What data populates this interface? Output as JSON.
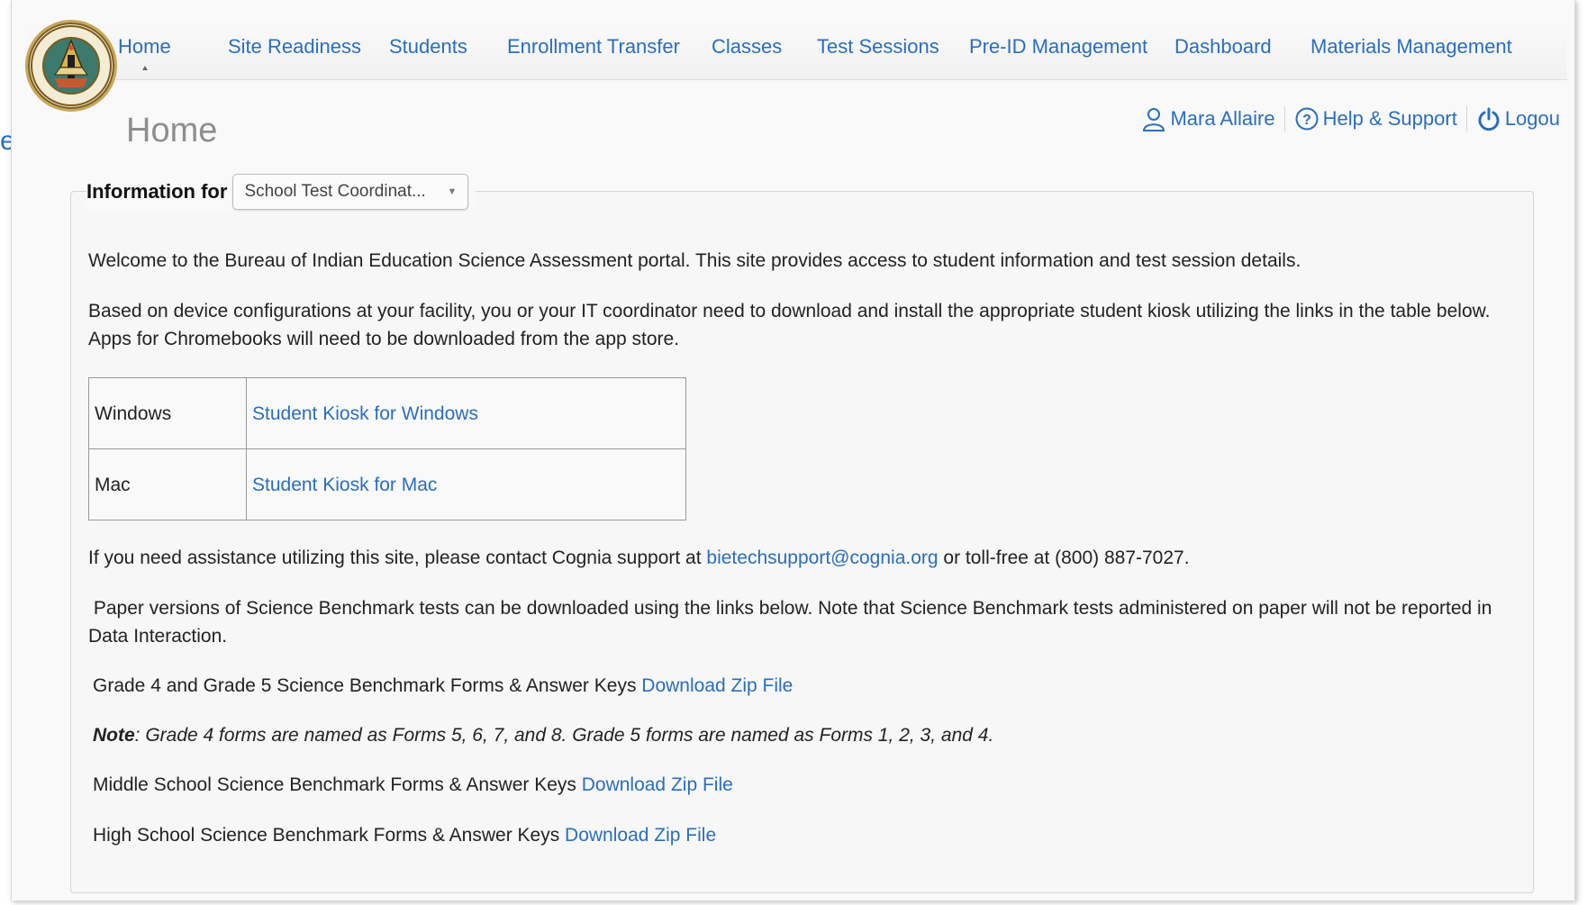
{
  "nav": {
    "items": [
      {
        "label": "Home"
      },
      {
        "label": "Site Readiness"
      },
      {
        "label": "Students"
      },
      {
        "label": "Enrollment Transfer"
      },
      {
        "label": "Classes"
      },
      {
        "label": "Test Sessions"
      },
      {
        "label": "Pre-ID Management"
      },
      {
        "label": "Dashboard"
      },
      {
        "label": "Materials Management"
      }
    ],
    "active": "Home"
  },
  "page_title": "Home",
  "user_bar": {
    "user_name": "Mara Allaire",
    "help_label": "Help & Support",
    "logout_label": "Logou"
  },
  "info_for": {
    "label": "Information for",
    "selected": "School Test Coordinat..."
  },
  "content": {
    "welcome": "Welcome to the Bureau of Indian Education Science Assessment portal. This site provides access to student information and test session details.",
    "based_on": "Based on device configurations at your facility, you or your IT coordinator need to download and install the appropriate student kiosk utilizing the links in the table below. Apps for Chromebooks will need to be downloaded from the app store.",
    "kiosks": [
      {
        "os": "Windows",
        "link": "Student Kiosk for Windows"
      },
      {
        "os": "Mac",
        "link": "Student Kiosk for Mac"
      }
    ],
    "assist_before": "If you need assistance utilizing this site, please contact Cognia support at ",
    "assist_email": "bietechsupport@cognia.org",
    "assist_after": " or toll-free at (800) 887-7027.",
    "paper": " Paper versions of Science Benchmark tests can be downloaded using the links below. Note that Science Benchmark tests administered on paper will not be reported in Data Interaction.",
    "grade45_text": "Grade 4 and Grade 5 Science Benchmark Forms & Answer Keys ",
    "note_label": "Note",
    "note_text": ": Grade 4 forms are named as Forms 5, 6, 7, and 8. Grade 5 forms are named as Forms 1, 2, 3, and 4.",
    "middle_text": "Middle School Science Benchmark Forms & Answer Keys ",
    "high_text": "High School Science Benchmark Forms & Answer Keys ",
    "download_label": "Download Zip File"
  },
  "colors": {
    "link": "#2a6ebb",
    "title": "#8e8e8e",
    "panel_bg": "#f7f7f7"
  },
  "icons": {
    "logo": "bureau-of-indian-education-seal",
    "user": "user-icon",
    "help": "help-circle-icon",
    "logout": "power-icon"
  }
}
